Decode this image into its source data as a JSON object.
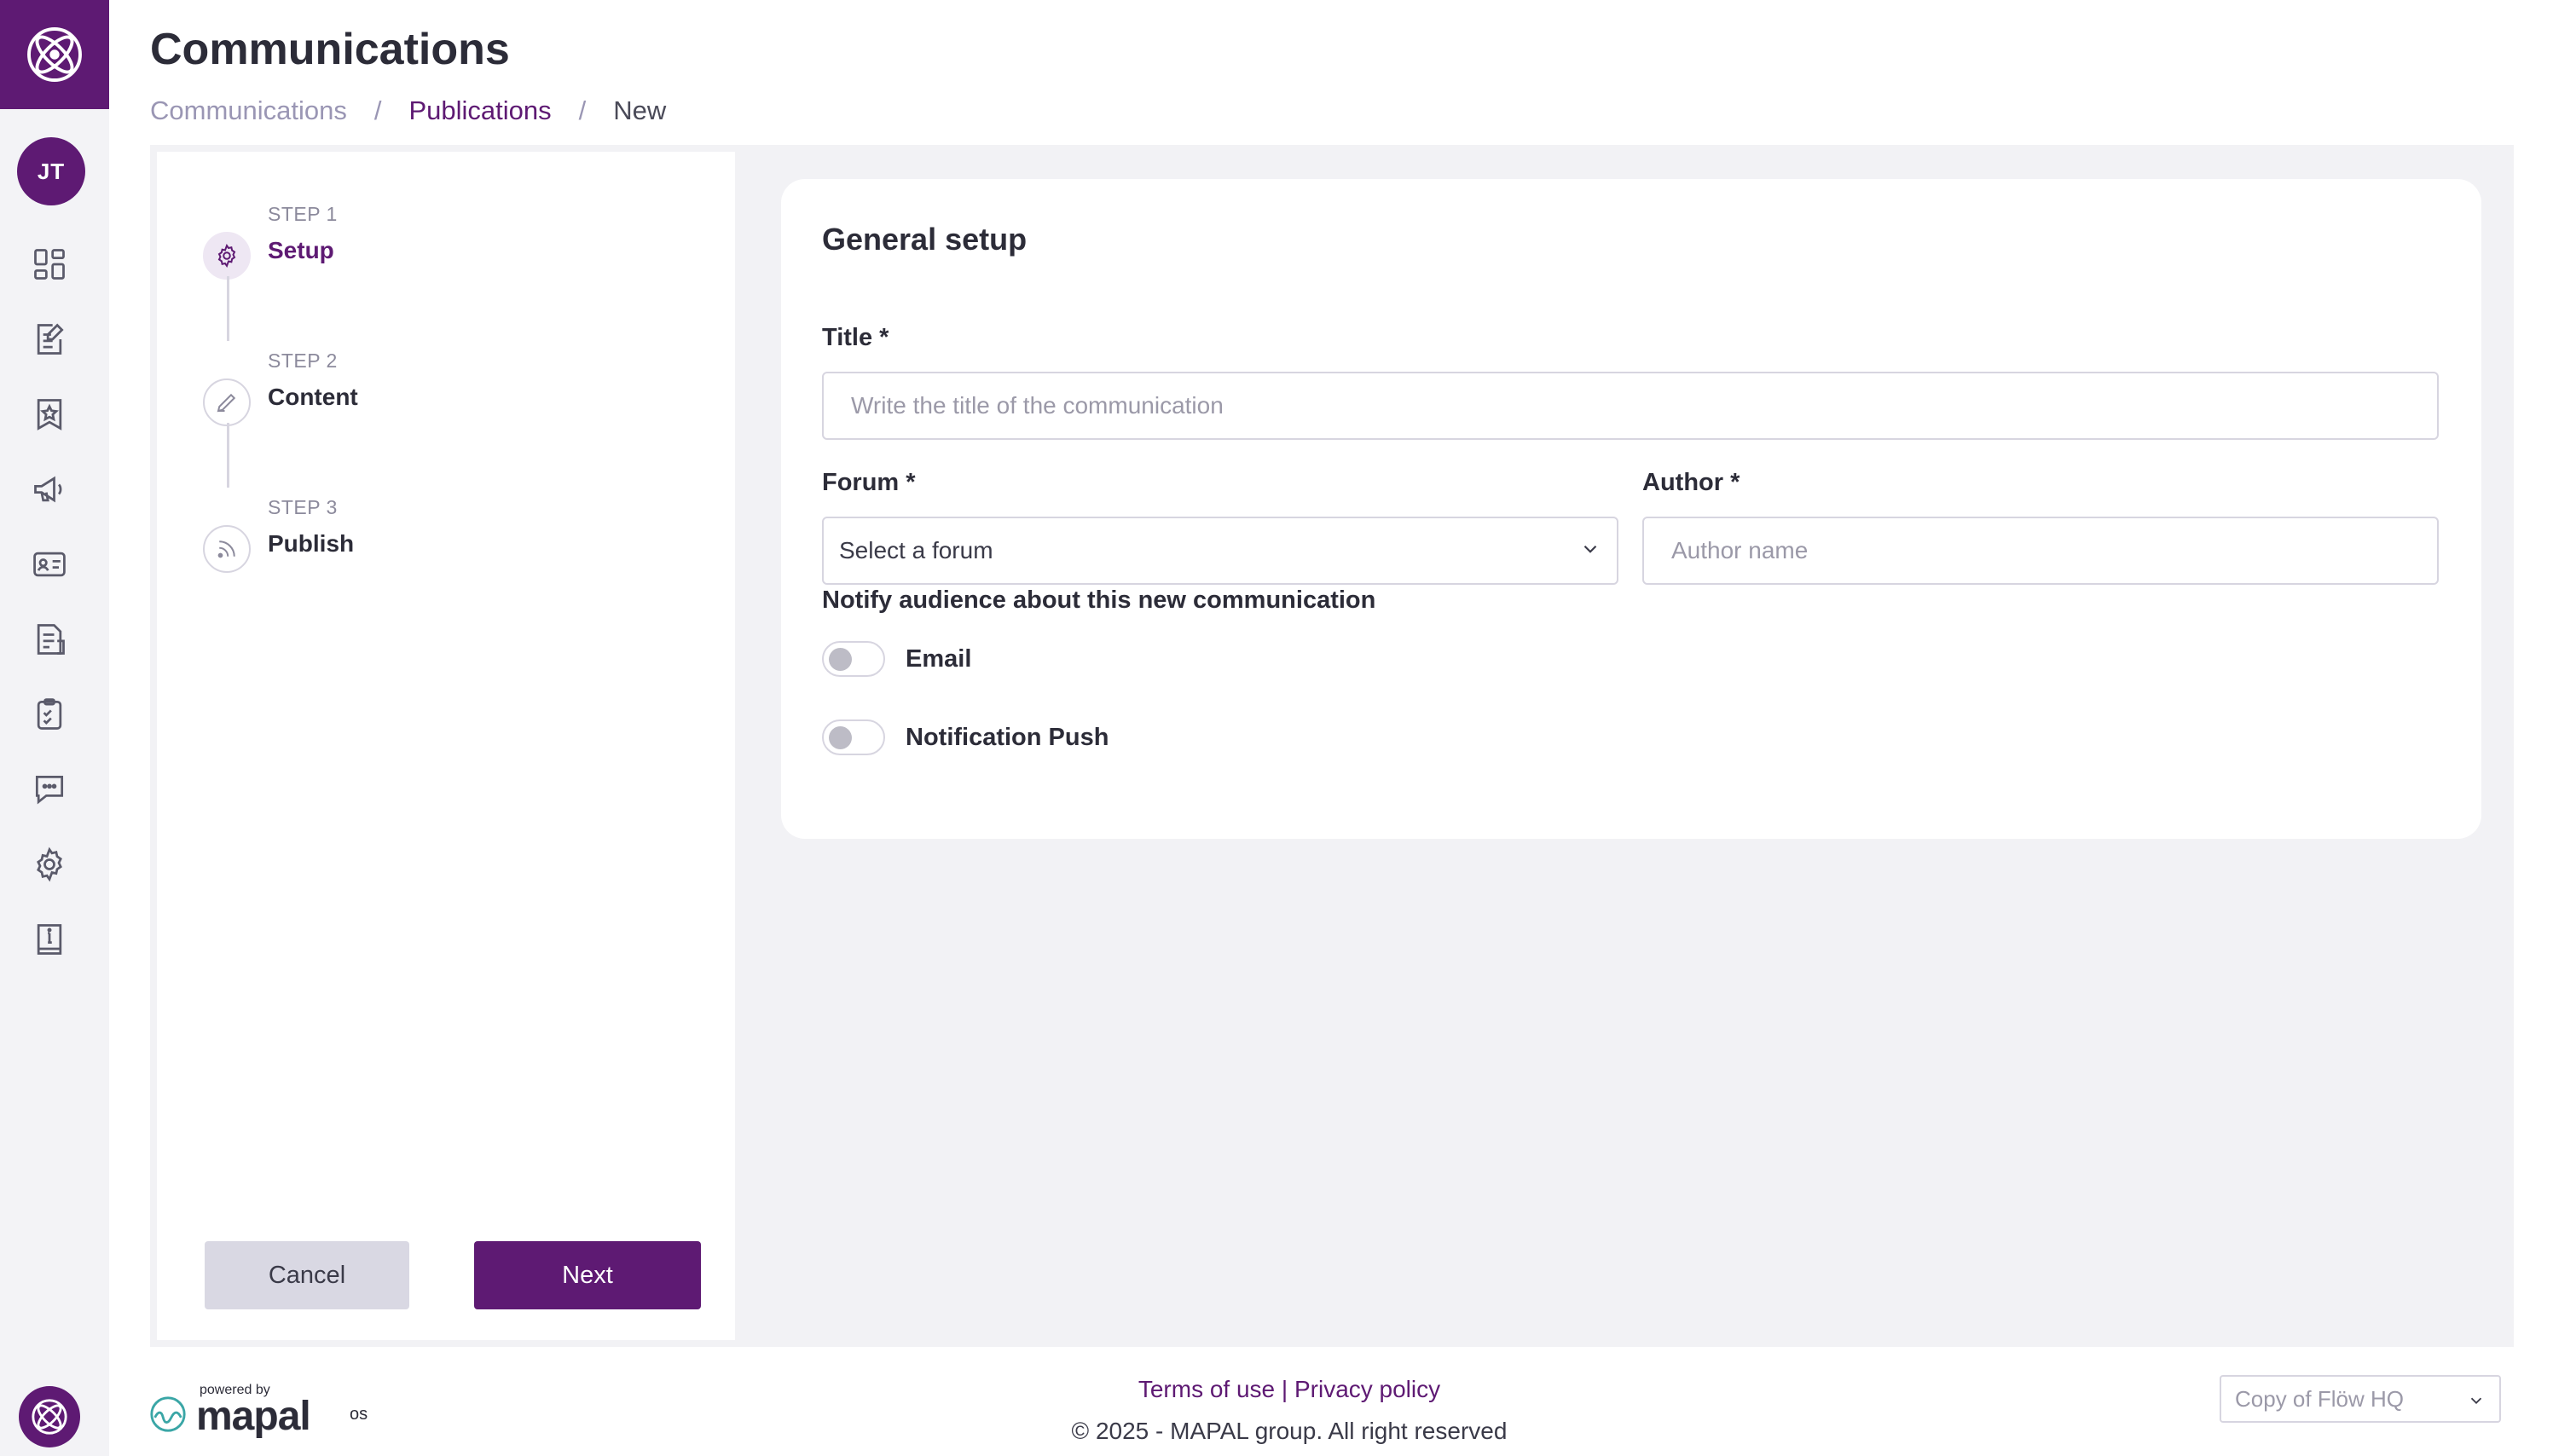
{
  "colors": {
    "brand": "#5e1a73",
    "rail_bg": "#f3f3f6",
    "main_bg": "#f2f2f5",
    "border": "#d7d5e0"
  },
  "sidebar": {
    "logo_icon": "atom-logo-icon",
    "avatar_initials": "JT",
    "items": [
      {
        "name": "dashboard",
        "icon": "dashboard-grid-icon"
      },
      {
        "name": "forms",
        "icon": "edit-document-icon"
      },
      {
        "name": "badges",
        "icon": "badge-star-icon"
      },
      {
        "name": "communications",
        "icon": "megaphone-icon"
      },
      {
        "name": "profiles",
        "icon": "id-card-icon"
      },
      {
        "name": "documents",
        "icon": "document-list-icon"
      },
      {
        "name": "checklists",
        "icon": "clipboard-check-icon"
      },
      {
        "name": "chat",
        "icon": "chat-bubble-icon"
      },
      {
        "name": "settings",
        "icon": "gear-icon"
      },
      {
        "name": "info",
        "icon": "info-book-icon"
      }
    ],
    "bottom_icon": "atom-logo-icon"
  },
  "header": {
    "title": "Communications",
    "breadcrumb": [
      {
        "label": "Communications"
      },
      {
        "label": "Publications"
      },
      {
        "label": "New"
      }
    ],
    "separator": "/"
  },
  "stepper": {
    "steps": [
      {
        "number": "STEP 1",
        "label": "Setup",
        "icon": "gear-icon",
        "active": true
      },
      {
        "number": "STEP 2",
        "label": "Content",
        "icon": "pencil-icon",
        "active": false
      },
      {
        "number": "STEP 3",
        "label": "Publish",
        "icon": "rss-icon",
        "active": false
      }
    ],
    "cancel_label": "Cancel",
    "next_label": "Next"
  },
  "form": {
    "title": "General setup",
    "title_field": {
      "label": "Title *",
      "placeholder": "Write the title of the communication",
      "value": ""
    },
    "forum_field": {
      "label": "Forum *",
      "value": "Select a forum"
    },
    "author_field": {
      "label": "Author *",
      "placeholder": "Author name",
      "value": ""
    },
    "notify_label": "Notify audience about this new communication",
    "toggles": [
      {
        "label": "Email",
        "on": false
      },
      {
        "label": "Notification Push",
        "on": false
      }
    ]
  },
  "footer": {
    "powered_by": "powered by",
    "brand": "mapal",
    "brand_suffix": "os",
    "terms": "Terms of use",
    "links_separator": "|",
    "privacy": "Privacy policy",
    "copyright": "© 2025 - MAPAL group. All right reserved",
    "location_value": "Copy of Flöw HQ"
  }
}
